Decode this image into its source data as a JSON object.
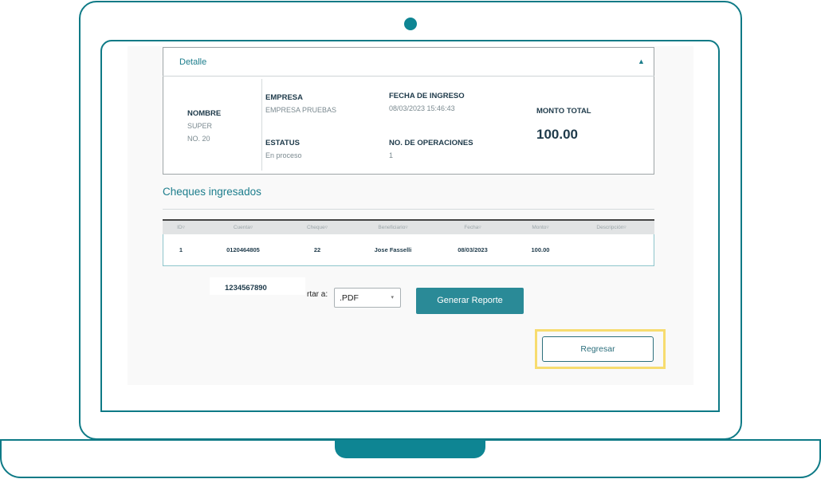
{
  "detail": {
    "title": "Detalle",
    "toggle_icon": "▲",
    "nombre_label": "NOMBRE",
    "nombre_line1": "SUPER",
    "nombre_line2": "NO. 20",
    "empresa_label": "EMPRESA",
    "empresa_value": "EMPRESA PRUEBAS",
    "fecha_label": "FECHA DE INGRESO",
    "fecha_value": "08/03/2023 15:46:43",
    "estatus_label": "ESTATUS",
    "estatus_value": "En proceso",
    "operaciones_label": "NO. DE OPERACIONES",
    "operaciones_value": "1",
    "monto_label": "MONTO TOTAL",
    "monto_value": "100.00"
  },
  "cheques": {
    "title": "Cheques ingresados",
    "columns": [
      "ID▿",
      "Cuenta▿",
      "Cheque▿",
      "Beneficiario▿",
      "Fecha▿",
      "Monto▿",
      "Descripción▿"
    ],
    "rows": [
      [
        "1",
        "0120464805",
        "22",
        "Jose Fasselli",
        "08/03/2023",
        "100.00",
        ""
      ]
    ]
  },
  "export": {
    "overlay_number": "1234567890",
    "label": "rtar a:",
    "selected": ".PDF",
    "caret": "▾",
    "generate_label": "Generar Reporte"
  },
  "back_label": "Regresar",
  "colors": {
    "accent": "#0e7a86",
    "button": "#2a8a97",
    "highlight": "#f7dc6f"
  }
}
